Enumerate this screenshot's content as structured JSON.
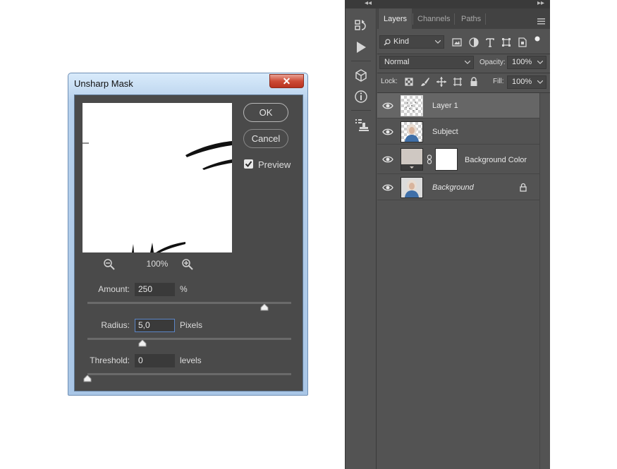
{
  "dialog": {
    "title": "Unsharp Mask",
    "close_glyph": "✕",
    "ok_label": "OK",
    "cancel_label": "Cancel",
    "preview_label": "Preview",
    "preview_checked": true,
    "zoom_level": "100%",
    "zoom_out_icon": "zoom-out-icon",
    "zoom_in_icon": "zoom-in-icon",
    "amount": {
      "label": "Amount:",
      "value": "250",
      "unit": "%",
      "slider_fraction": 0.87
    },
    "radius": {
      "label": "Radius:",
      "value": "5,0",
      "unit": "Pixels",
      "slider_fraction": 0.27
    },
    "threshold": {
      "label": "Threshold:",
      "value": "0",
      "unit": "levels",
      "slider_fraction": 0.0
    }
  },
  "panel": {
    "collapse_left": "◂◂",
    "collapse_right": "▸▸",
    "tabs": [
      {
        "label": "Layers",
        "active": true
      },
      {
        "label": "Channels",
        "active": false
      },
      {
        "label": "Paths",
        "active": false
      }
    ],
    "filter_kind_label": "Kind",
    "blend_mode": "Normal",
    "opacity_label": "Opacity:",
    "opacity_value": "100%",
    "lock_label": "Lock:",
    "fill_label": "Fill:",
    "fill_value": "100%",
    "layers": [
      {
        "name": "Layer 1",
        "visible": true,
        "selected": true,
        "italic": false,
        "locked": false,
        "thumbnail": "transparent-speckle"
      },
      {
        "name": "Subject",
        "visible": true,
        "selected": false,
        "italic": false,
        "locked": false,
        "thumbnail": "portrait"
      },
      {
        "name": "Background Color",
        "visible": true,
        "selected": false,
        "italic": false,
        "locked": false,
        "thumbnail": "fill-with-mask"
      },
      {
        "name": "Background",
        "visible": true,
        "selected": false,
        "italic": true,
        "locked": true,
        "thumbnail": "portrait"
      }
    ]
  },
  "colors": {
    "panel_bg": "#535353",
    "selected_layer": "#666666",
    "dialog_body": "#4a4a4a",
    "dialog_frame": "#b7d1ec",
    "close_button": "#cd4b36",
    "fill_layer_color": "#cfc8c2"
  }
}
